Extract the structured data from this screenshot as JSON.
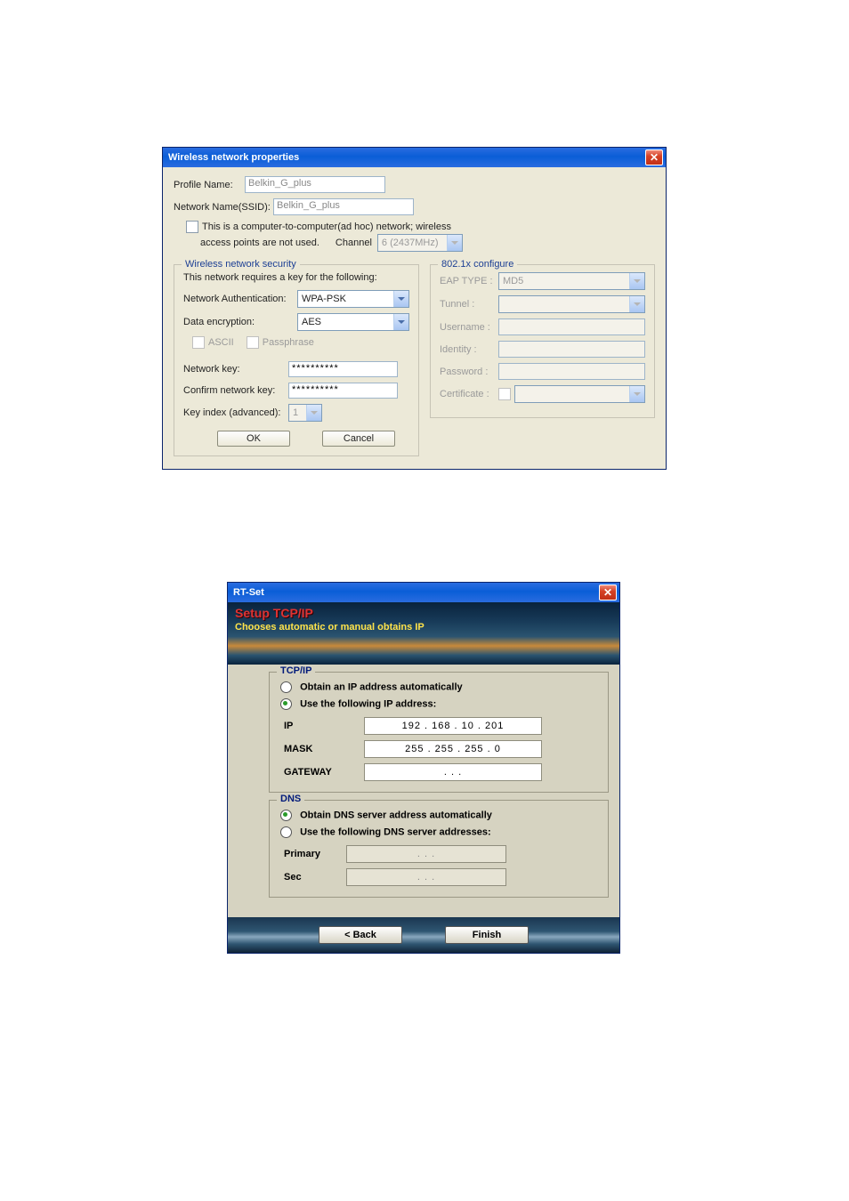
{
  "dlg1": {
    "title": "Wireless network properties",
    "profileName_label": "Profile Name:",
    "profileName_value": "Belkin_G_plus",
    "ssid_label": "Network Name(SSID):",
    "ssid_value": "Belkin_G_plus",
    "adhoc_text1": "This is a computer-to-computer(ad hoc) network; wireless",
    "adhoc_text2": "access points are not used.",
    "channel_label": "Channel",
    "channel_value": "6 (2437MHz)",
    "security": {
      "legend": "Wireless network security",
      "requires": "This network requires a key for the following:",
      "auth_label": "Network Authentication:",
      "auth_value": "WPA-PSK",
      "enc_label": "Data encryption:",
      "enc_value": "AES",
      "ascii_label": "ASCII",
      "pass_label": "Passphrase",
      "key_label": "Network key:",
      "key_value": "**********",
      "confirm_label": "Confirm network key:",
      "confirm_value": "**********",
      "keyindex_label": "Key index (advanced):",
      "keyindex_value": "1"
    },
    "dot1x": {
      "legend": "802.1x configure",
      "eap_label": "EAP TYPE :",
      "eap_value": "MD5",
      "tunnel_label": "Tunnel :",
      "user_label": "Username :",
      "identity_label": "Identity :",
      "password_label": "Password :",
      "cert_label": "Certificate :"
    },
    "ok": "OK",
    "cancel": "Cancel"
  },
  "dlg2": {
    "title": "RT-Set",
    "banner_h1": "Setup TCP/IP",
    "banner_h2": "Chooses automatic or manual obtains IP",
    "tcpip": {
      "legend": "TCP/IP",
      "auto": "Obtain an IP address automatically",
      "manual": "Use the following IP address:",
      "ip_label": "IP",
      "ip_value": "192  .  168  .   10   .  201",
      "mask_label": "MASK",
      "mask_value": "255  .  255  .  255  .    0",
      "gw_label": "GATEWAY",
      "gw_value": ".        .        ."
    },
    "dns": {
      "legend": "DNS",
      "auto": "Obtain DNS server address automatically",
      "manual": "Use the following DNS server addresses:",
      "primary_label": "Primary",
      "primary_value": ".        .        .",
      "sec_label": "Sec",
      "sec_value": ".        .        ."
    },
    "back": "< Back",
    "finish": "Finish"
  }
}
